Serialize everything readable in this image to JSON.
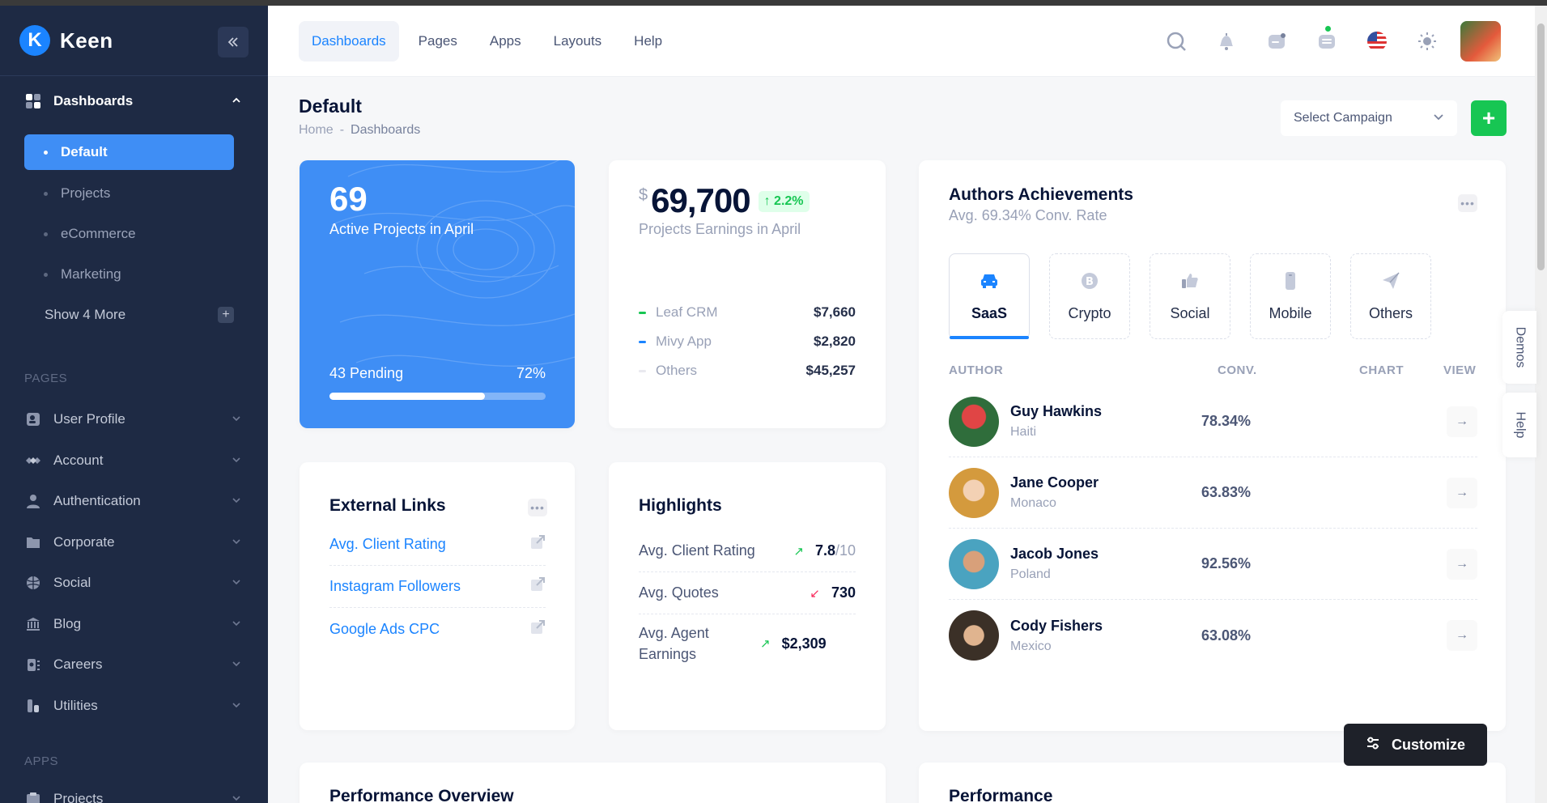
{
  "brand": {
    "name": "Keen",
    "logo_letter": "K"
  },
  "sidebar": {
    "dashboards": {
      "label": "Dashboards",
      "icon": "grid-icon"
    },
    "sub_items": [
      {
        "label": "Default",
        "active": true
      },
      {
        "label": "Projects",
        "active": false
      },
      {
        "label": "eCommerce",
        "active": false
      },
      {
        "label": "Marketing",
        "active": false
      }
    ],
    "show_more": "Show 4 More",
    "pages_section": "PAGES",
    "pages": [
      {
        "label": "User Profile",
        "icon": "user-profile-icon"
      },
      {
        "label": "Account",
        "icon": "account-icon"
      },
      {
        "label": "Authentication",
        "icon": "person-icon"
      },
      {
        "label": "Corporate",
        "icon": "folder-icon"
      },
      {
        "label": "Social",
        "icon": "basketball-icon"
      },
      {
        "label": "Blog",
        "icon": "bank-icon"
      },
      {
        "label": "Careers",
        "icon": "careers-icon"
      },
      {
        "label": "Utilities",
        "icon": "utilities-icon"
      }
    ],
    "apps_section": "APPS",
    "apps": [
      {
        "label": "Projects",
        "icon": "projects-icon"
      }
    ]
  },
  "header": {
    "nav": [
      "Dashboards",
      "Pages",
      "Apps",
      "Layouts",
      "Help"
    ],
    "active_nav": "Dashboards"
  },
  "toolbar": {
    "title": "Default",
    "breadcrumb": [
      "Home",
      "Dashboards"
    ],
    "campaign_placeholder": "Select Campaign",
    "add_label": "+"
  },
  "projects_card": {
    "value": "69",
    "subtitle": "Active Projects in April",
    "pending": "43 Pending",
    "percent_label": "72%",
    "progress": 0.72
  },
  "earnings_card": {
    "currency": "$",
    "value": "69,700",
    "change": "2.2%",
    "subtitle": "Projects Earnings in April",
    "rows": [
      {
        "label": "Leaf CRM",
        "amount": "$7,660",
        "color": "#17c653"
      },
      {
        "label": "Mivy App",
        "amount": "$2,820",
        "color": "#1b84ff"
      },
      {
        "label": "Others",
        "amount": "$45,257",
        "color": "#e9e9ef"
      }
    ]
  },
  "authors": {
    "title": "Authors Achievements",
    "subtitle": "Avg. 69.34% Conv. Rate",
    "tabs": [
      "SaaS",
      "Crypto",
      "Social",
      "Mobile",
      "Others"
    ],
    "columns": [
      "AUTHOR",
      "CONV.",
      "CHART",
      "VIEW"
    ],
    "rows": [
      {
        "name": "Guy Hawkins",
        "country": "Haiti",
        "conv": "78.34%"
      },
      {
        "name": "Jane Cooper",
        "country": "Monaco",
        "conv": "63.83%"
      },
      {
        "name": "Jacob Jones",
        "country": "Poland",
        "conv": "92.56%"
      },
      {
        "name": "Cody Fishers",
        "country": "Mexico",
        "conv": "63.08%"
      }
    ]
  },
  "external_links": {
    "title": "External Links",
    "links": [
      "Avg. Client Rating",
      "Instagram Followers",
      "Google Ads CPC"
    ]
  },
  "highlights": {
    "title": "Highlights",
    "rows": [
      {
        "label": "Avg. Client Rating",
        "value": "7.8",
        "denominator": "/10",
        "trend": "up"
      },
      {
        "label": "Avg. Quotes",
        "value": "730",
        "denominator": "",
        "trend": "down"
      },
      {
        "label": "Avg. Agent Earnings",
        "value": "$2,309",
        "denominator": "",
        "trend": "up"
      }
    ]
  },
  "bottom": {
    "perf_overview": "Performance Overview",
    "perf": "Performance"
  },
  "side_tabs": {
    "demos": "Demos",
    "help": "Help"
  },
  "customize": "Customize",
  "colors": {
    "primary": "#1b84ff",
    "success": "#17c653",
    "danger": "#f8285a",
    "sidebar": "#1e2a44"
  }
}
